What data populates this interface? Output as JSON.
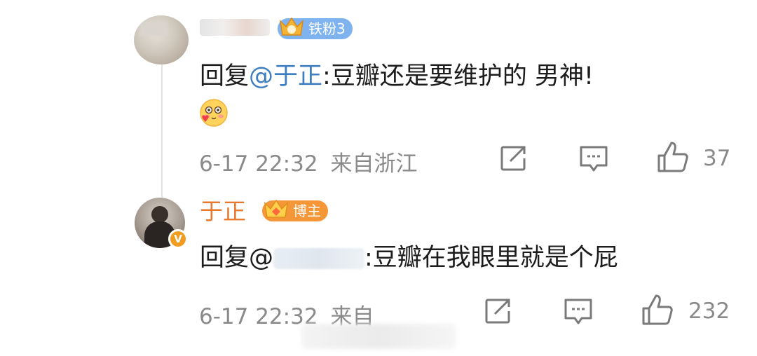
{
  "comments": [
    {
      "badge": "铁粉3",
      "reply_prefix": "回复",
      "mention": "@于正",
      "text": ":豆瓣还是要维护的 男神!",
      "emoji": "blush-heart-emoji",
      "time": "6-17 22:32",
      "location": "来自浙江",
      "likes": "37"
    },
    {
      "username": "于正",
      "verified": "V",
      "badge": "博主",
      "reply_prefix": "回复@",
      "text": ":豆瓣在我眼里就是个屁",
      "time": "6-17 22:32",
      "location": "来自",
      "likes": "232"
    }
  ],
  "icons": [
    "share-icon",
    "comment-icon",
    "like-icon"
  ],
  "colors": {
    "username": "#e7792f",
    "mention": "#3d7ec1",
    "fan_badge": "#7fb3ef",
    "blogger_badge": "#f59638",
    "meta": "#8a8a8a"
  }
}
